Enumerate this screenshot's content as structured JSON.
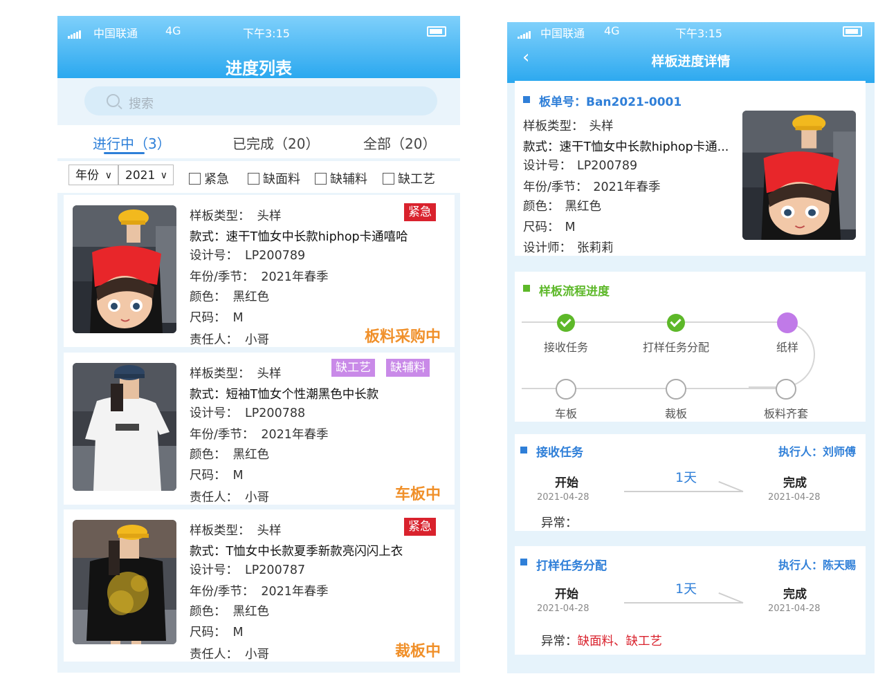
{
  "status_bar": {
    "carrier": "中国联通",
    "network": "4G",
    "time": "下午3:15"
  },
  "list_screen": {
    "title": "进度列表",
    "search": {
      "placeholder": "搜索"
    },
    "tabs": [
      {
        "label": "进行中（3）",
        "active": true
      },
      {
        "label": "已完成（20）",
        "active": false
      },
      {
        "label": "全部（20）",
        "active": false
      }
    ],
    "filters": {
      "type_select": "年份",
      "year_select": "2021",
      "checkboxes": [
        "紧急",
        "缺面料",
        "缺辅料",
        "缺工艺"
      ]
    },
    "field_labels": {
      "type": "样板类型：",
      "style": "款式：",
      "design_no": "设计号：",
      "season": "年份/季节：",
      "color": "颜色：",
      "size": "尺码：",
      "owner": "责任人："
    },
    "items": [
      {
        "type": "头样",
        "style": "速干T恤女中长款hiphop卡通嘻哈",
        "design_no": "LP200789",
        "season": "2021年春季",
        "color": "黑红色",
        "size": "M",
        "owner": "小哥",
        "badges": [
          "紧急"
        ],
        "status": "板料采购中"
      },
      {
        "type": "头样",
        "style": "短袖T恤女个性潮黑色中长款",
        "design_no": "LP200788",
        "season": "2021年春季",
        "color": "黑红色",
        "size": "M",
        "owner": "小哥",
        "badges": [
          "缺工艺",
          "缺辅料"
        ],
        "status": "车板中"
      },
      {
        "type": "头样",
        "style": "T恤女中长款夏季新款亮闪闪上衣",
        "design_no": "LP200787",
        "season": "2021年春季",
        "color": "黑红色",
        "size": "M",
        "owner": "小哥",
        "badges": [
          "紧急"
        ],
        "status": "裁板中"
      }
    ]
  },
  "detail_screen": {
    "title": "样板进度详情",
    "order": {
      "order_no_label": "板单号：",
      "order_no": "Ban2021-0001",
      "type_label": "样板类型：",
      "type": "头样",
      "style_label": "款式：",
      "style": "速干T恤女中长款hiphop卡通...",
      "design_no_label": "设计号：",
      "design_no": "LP200789",
      "season_label": "年份/季节：",
      "season": "2021年春季",
      "color_label": "颜色：",
      "color": "黑红色",
      "size_label": "尺码：",
      "size": "M",
      "designer_label": "设计师：",
      "designer": "张莉莉"
    },
    "flow": {
      "title": "样板流程进度",
      "steps": [
        {
          "label": "接收任务",
          "state": "done"
        },
        {
          "label": "打样任务分配",
          "state": "done"
        },
        {
          "label": "纸样",
          "state": "current"
        },
        {
          "label": "车板",
          "state": "todo"
        },
        {
          "label": "裁板",
          "state": "todo"
        },
        {
          "label": "板料齐套",
          "state": "todo"
        }
      ]
    },
    "tasks": [
      {
        "name": "接收任务",
        "executor": "执行人：刘师傅",
        "start_label": "开始",
        "start_date": "2021-04-28",
        "duration": "1天",
        "end_label": "完成",
        "end_date": "2021-04-28",
        "abnormal_label": "异常：",
        "abnormal": ""
      },
      {
        "name": "打样任务分配",
        "executor": "执行人：陈天赐",
        "start_label": "开始",
        "start_date": "2021-04-28",
        "duration": "1天",
        "end_label": "完成",
        "end_date": "2021-04-28",
        "abnormal_label": "异常：",
        "abnormal": "缺面料、缺工艺"
      }
    ]
  },
  "colors": {
    "header": "#2ba8ef",
    "accent_blue": "#2f7fd8",
    "urgent": "#d9222d",
    "lack": "#c98ae8",
    "status_orange": "#f0902a",
    "done_green": "#5db829"
  }
}
